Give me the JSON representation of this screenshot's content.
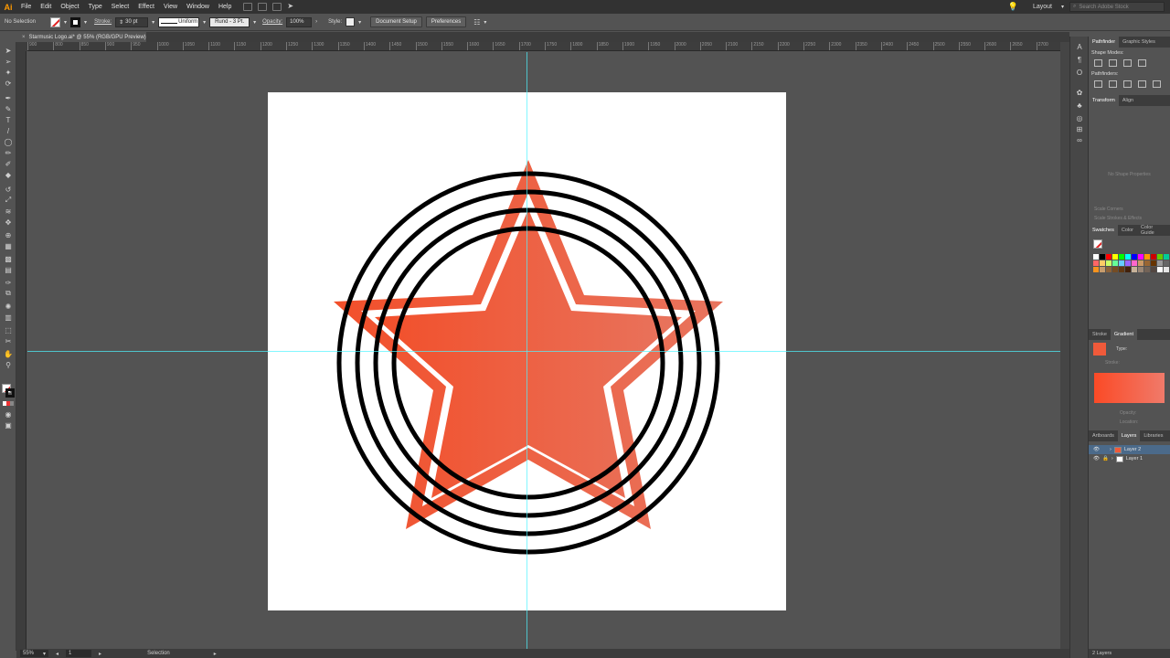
{
  "app": {
    "logo": "Ai"
  },
  "menu": [
    "File",
    "Edit",
    "Object",
    "Type",
    "Select",
    "Effect",
    "View",
    "Window",
    "Help"
  ],
  "menubar_right": {
    "workspace": "Layout",
    "search_placeholder": "Search Adobe Stock"
  },
  "control_bar": {
    "selection": "No Selection",
    "stroke_label": "Stroke:",
    "stroke_weight": "30 pt",
    "stroke_profile": "Uniform",
    "brush": "Rund - 3 Pt.",
    "opacity_label": "Opacity:",
    "opacity": "100%",
    "style_label": "Style:",
    "document_setup": "Document Setup",
    "preferences": "Preferences"
  },
  "document": {
    "tab_title": "Starmusic Logo.ai* @ 55% (RGB/GPU Preview)"
  },
  "ruler": {
    "ticks": [
      "900",
      "800",
      "850",
      "900",
      "950",
      "1000",
      "1050",
      "1100",
      "1150",
      "1200",
      "1250",
      "1300",
      "1350",
      "1400",
      "1450",
      "1500",
      "1550",
      "1600",
      "1650",
      "1700",
      "1750",
      "1800",
      "1850",
      "1900",
      "1950",
      "2000",
      "2050",
      "2100",
      "2150",
      "2200",
      "2250",
      "2300",
      "2350",
      "2400",
      "2450",
      "2500",
      "2550",
      "2600",
      "2650",
      "2700",
      "2750",
      "2800",
      "2850",
      "2900",
      "2950"
    ]
  },
  "artwork": {
    "star_gradient_start": "#f24f2a",
    "star_gradient_end": "#e8745e",
    "ring_color": "#000000"
  },
  "status": {
    "zoom": "55%",
    "page": "1",
    "tool": "Selection"
  },
  "panels": {
    "pathfinder_tabs": [
      "Pathfinder",
      "Graphic Styles"
    ],
    "shape_modes": "Shape Modes:",
    "pathfinders": "Pathfinders:",
    "transform_tabs": [
      "Transform",
      "Align"
    ],
    "no_shape": "No Shape Properties",
    "scale_corners": "Scale Corners",
    "scale_strokes": "Scale Strokes & Effects",
    "swatches_tabs": [
      "Swatches",
      "Color",
      "Color Guide"
    ],
    "stroke_gradient_tabs": [
      "Stroke",
      "Gradient"
    ],
    "type_label": "Type:",
    "stroke_label": "Stroke:",
    "opacity_label": "Opacity:",
    "location_label": "Location:",
    "layers_tabs": [
      "Artboards",
      "Layers",
      "Libraries"
    ],
    "layers": [
      "Layer 2",
      "Layer 1"
    ],
    "layers_count": "2 Layers"
  },
  "swatch_colors": [
    "#ffffff",
    "#000000",
    "#ff0000",
    "#ffff00",
    "#00ff00",
    "#00ffff",
    "#0000ff",
    "#ff00ff",
    "#ff9900",
    "#cc0000",
    "#66cc00",
    "#00cc99",
    "#0099ff",
    "#6600cc",
    "#ff6666",
    "#ffcc66",
    "#ccff66",
    "#66ff99",
    "#66ccff",
    "#9966ff",
    "#ff66cc",
    "#cc9966",
    "#996633",
    "#663300",
    "#999999",
    "#666666",
    "#333333",
    "#cccccc",
    "#f7931e",
    "#c69c6d",
    "#8c6239",
    "#754c24",
    "#603813",
    "#42210b",
    "#c7b299",
    "#998675",
    "#736357",
    "#534741",
    "#ffffff",
    "#e6e6e6",
    "#b3b3b3",
    "#808080"
  ]
}
